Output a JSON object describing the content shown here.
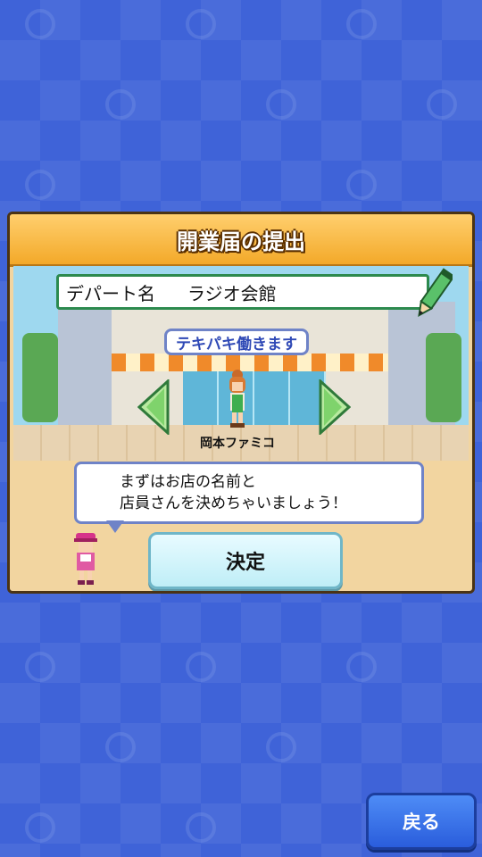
{
  "dialog": {
    "title": "開業届の提出",
    "department_label": "デパート名",
    "department_name": "ラジオ会館",
    "staff_catchphrase": "テキパキ働きます",
    "staff_name": "岡本ファミコ",
    "message_line1": "まずはお店の名前と",
    "message_line2": "店員さんを決めちゃいましょう！",
    "confirm_label": "決定"
  },
  "footer": {
    "back_label": "戻る"
  },
  "icons": {
    "prev": "chevron-left-icon",
    "next": "chevron-right-icon",
    "edit": "pencil-icon"
  },
  "colors": {
    "background": "#3f63d8",
    "header": "#f3a929",
    "field_border": "#2c8a4e",
    "back_button": "#2a5ddc",
    "confirm_button": "#bfeef7"
  }
}
